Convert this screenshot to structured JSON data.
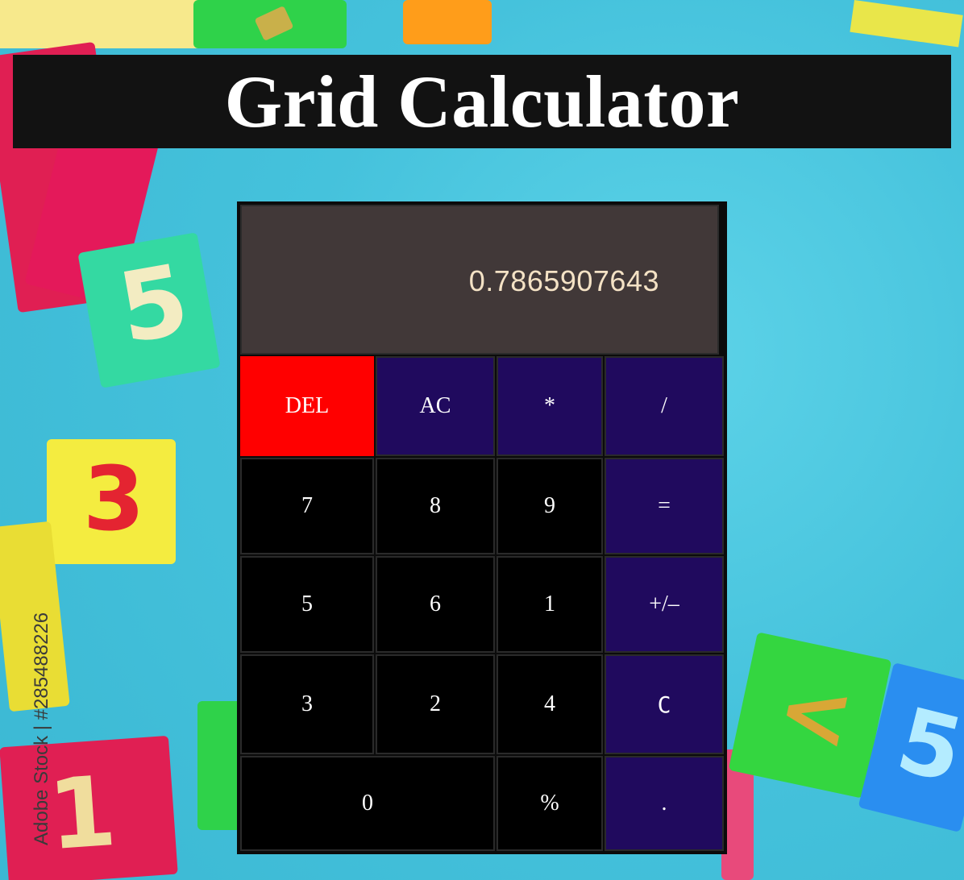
{
  "page": {
    "title": "Grid Calculator"
  },
  "background": {
    "watermark": "Adobe Stock | #285488226",
    "block_digits": [
      "5",
      "3",
      "1",
      "<",
      "5"
    ]
  },
  "calculator": {
    "display_value": "0.7865907643",
    "keys": {
      "del": "DEL",
      "ac": "AC",
      "multiply": "*",
      "divide": "/",
      "seven": "7",
      "eight": "8",
      "nine": "9",
      "equals": "=",
      "five": "5",
      "six": "6",
      "one": "1",
      "plus_minus": "+/–",
      "three": "3",
      "two": "2",
      "four": "4",
      "clear": "C",
      "zero": "0",
      "percent": "%",
      "decimal": "."
    }
  },
  "colors": {
    "title_bar": "#121212",
    "display_bg": "#413838",
    "display_text": "#f4e2c5",
    "operator_key": "#200a5e",
    "delete_key": "#ff0000",
    "number_key": "#000000"
  }
}
